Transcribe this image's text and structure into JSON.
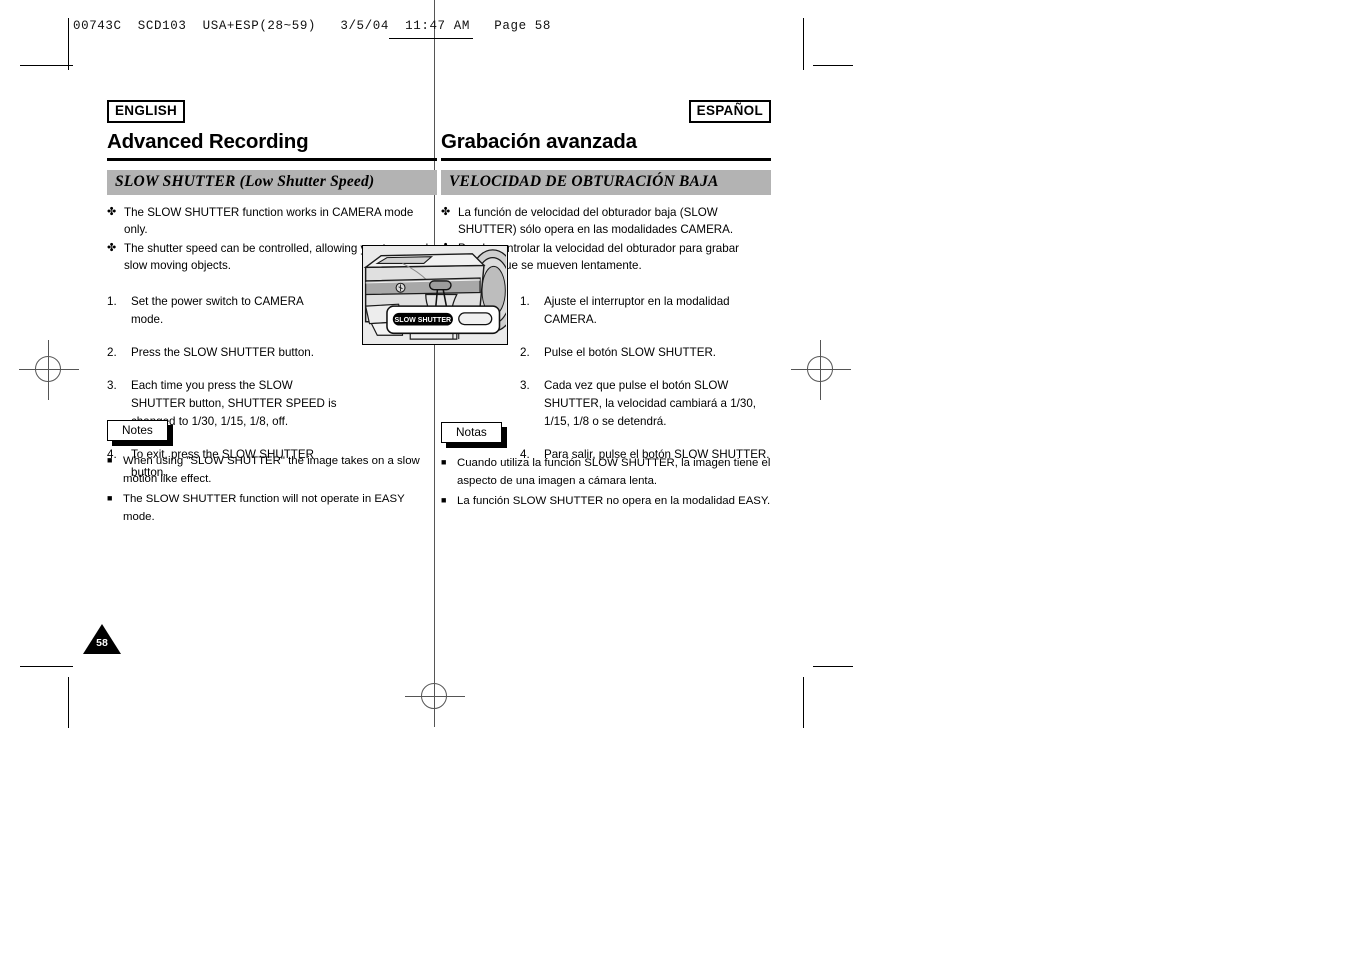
{
  "file_header": {
    "text": "00743C  SCD103  USA+ESP(28~59)   3/5/04  11:47 AM   Page 58"
  },
  "english": {
    "lang_tag": "ENGLISH",
    "chapter_title": "Advanced Recording",
    "section_title": "SLOW SHUTTER (Low Shutter Speed)",
    "bullet_glyph": "✤",
    "bullets": [
      "The SLOW SHUTTER function works in CAMERA mode only.",
      "The shutter speed can be controlled, allowing you to record slow moving objects."
    ],
    "steps": [
      {
        "num": "1.",
        "text": "Set the power switch to CAMERA mode."
      },
      {
        "num": "2.",
        "text": "Press the SLOW SHUTTER button."
      },
      {
        "num": "3.",
        "text": "Each time you press the SLOW SHUTTER button, SHUTTER SPEED is changed to 1/30, 1/15, 1/8, off."
      },
      {
        "num": "4.",
        "text": "To exit, press the SLOW SHUTTER button."
      }
    ],
    "notes_label": "Notes",
    "note_glyph": "■",
    "notes": [
      "When using \"SLOW SHUTTER\" the image takes on a slow motion like effect.",
      "The SLOW SHUTTER function will not operate in EASY mode."
    ]
  },
  "spanish": {
    "lang_tag": "ESPAÑOL",
    "chapter_title": "Grabación avanzada",
    "section_title": "VELOCIDAD DE OBTURACIÓN BAJA",
    "bullet_glyph": "✤",
    "bullets": [
      "La función de velocidad del obturador baja (SLOW SHUTTER) sólo opera en las modalidades CAMERA.",
      "Puede controlar la velocidad del obturador para grabar objetos que se mueven lentamente."
    ],
    "steps": [
      {
        "num": "1.",
        "text": "Ajuste el interruptor en la modalidad CAMERA."
      },
      {
        "num": "2.",
        "text": "Pulse el botón SLOW SHUTTER."
      },
      {
        "num": "3.",
        "text": "Cada vez que pulse el botón SLOW SHUTTER, la velocidad cambiará a 1/30, 1/15, 1/8 o se detendrá."
      },
      {
        "num": "4.",
        "text": "Para salir, pulse el botón SLOW SHUTTER."
      }
    ],
    "notes_label": "Notas",
    "note_glyph": "■",
    "notes": [
      "Cuando utiliza la función SLOW SHUTTER, la imagen tiene el aspecto de una imagen a cámara lenta.",
      "La función SLOW SHUTTER no opera en la modalidad EASY."
    ]
  },
  "figure": {
    "caption_button_label": "SLOW SHUTTER"
  },
  "page_number": "58",
  "colors": {
    "section_bar": "#b3b3b3",
    "rule": "#000000",
    "mark": "#555555"
  }
}
